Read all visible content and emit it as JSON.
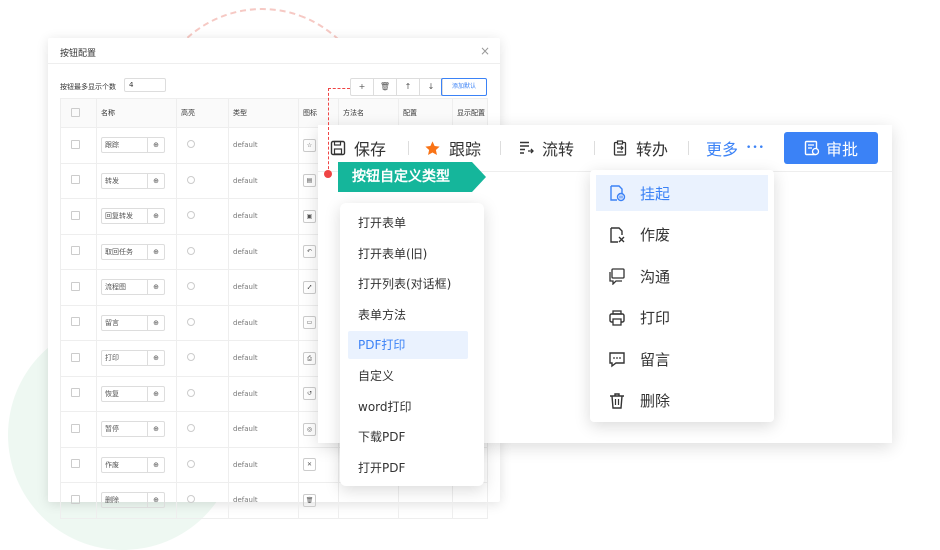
{
  "dialog": {
    "title": "按钮配置",
    "close": "×",
    "max_label": "按钮最多显示个数",
    "max_value": "4",
    "tools": [
      "+",
      "🗑",
      "↑",
      "↓"
    ],
    "add_default": "添加默认",
    "columns": [
      "",
      "名称",
      "高亮",
      "类型",
      "图标",
      "方法名",
      "配置",
      "显示配置"
    ],
    "rows": [
      {
        "name": "跟踪",
        "type": "default",
        "icon": "☆"
      },
      {
        "name": "转发",
        "type": "default",
        "icon": "▤"
      },
      {
        "name": "回复转发",
        "type": "default",
        "icon": "▣"
      },
      {
        "name": "取回任务",
        "type": "default",
        "icon": "↶"
      },
      {
        "name": "流程图",
        "type": "default",
        "icon": "⑇"
      },
      {
        "name": "留言",
        "type": "default",
        "icon": "▭"
      },
      {
        "name": "打印",
        "type": "default",
        "icon": "⎙"
      },
      {
        "name": "恢复",
        "type": "default",
        "icon": "↺"
      },
      {
        "name": "暂停",
        "type": "default",
        "icon": "◎"
      },
      {
        "name": "作废",
        "type": "default",
        "icon": "✕"
      },
      {
        "name": "删除",
        "type": "default",
        "icon": "🗑"
      }
    ],
    "globe_icon": "⊕"
  },
  "toolbar": {
    "save": "保存",
    "track": "跟踪",
    "flow": "流转",
    "transfer": "转办",
    "more": "更多",
    "more_dots": "•••",
    "approve": "审批"
  },
  "tag": "按钮自定义类型",
  "type_menu": [
    "打开表单",
    "打开表单(旧)",
    "打开列表(对话框)",
    "表单方法",
    "PDF打印",
    "自定义",
    "word打印",
    "下载PDF",
    "打开PDF"
  ],
  "type_menu_active": 4,
  "more_menu": [
    "挂起",
    "作废",
    "沟通",
    "打印",
    "留言",
    "删除"
  ],
  "colors": {
    "accent": "#3b82f6",
    "teal": "#15b69b",
    "connector": "#ef4444",
    "star": "#f97316"
  }
}
